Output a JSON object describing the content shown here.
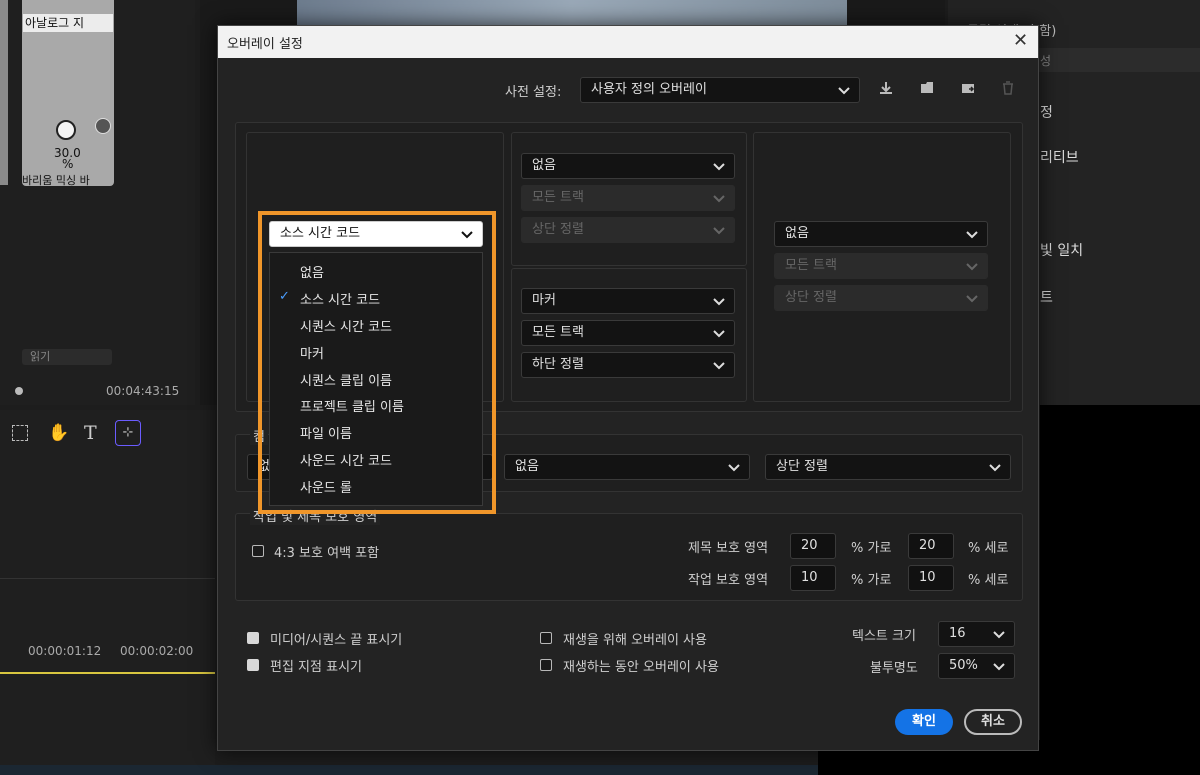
{
  "background": {
    "analog_label": "아날로그 지",
    "knob_value": "30.0",
    "knob_unit": "%",
    "mix_label": "바리움 믹싱 바",
    "read_label": "읽기",
    "timecode": "00:04:43:15",
    "timeline_ticks": [
      "00:00:01:12",
      "00:00:02:00"
    ],
    "right_panel": [
      "(클립 선택 안 함)",
      "성",
      "정",
      "리티브",
      "",
      "빛 일치",
      "트"
    ]
  },
  "dialog": {
    "title": "오버레이 설정",
    "preset_label": "사전 설정:",
    "preset_value": "사용자 정의 오버레이",
    "left_select": "소스 시간 코드",
    "mid_top": [
      "없음",
      "모든 트랙",
      "상단 정렬"
    ],
    "mid_bottom": [
      "마커",
      "모든 트랙",
      "하단 정렬"
    ],
    "right_col": [
      "없음",
      "모든 트랙",
      "상단 정렬"
    ],
    "bottom_row_label": "컴",
    "bottom_row": [
      "없",
      "없음",
      "상단 정렬"
    ],
    "dropdown_items": [
      "없음",
      "소스 시간 코드",
      "시퀀스 시간 코드",
      "마커",
      "시퀀스 클립 이름",
      "프로젝트 클립 이름",
      "파일 이름",
      "사운드 시간 코드",
      "사운드 롤"
    ],
    "dropdown_selected": 1,
    "safe_section_title": "작업 및 제목 보호 영역",
    "safe_43_label": "4:3 보호 여백 포함",
    "title_safe_label": "제목 보호 영역",
    "action_safe_label": "작업 보호 영역",
    "title_safe_h": "20",
    "title_safe_v": "20",
    "action_safe_h": "10",
    "action_safe_v": "10",
    "pct_h": "% 가로",
    "pct_v": "% 세로",
    "pct_h2": "% 가로",
    "pct_v2": "% 세로",
    "opt1": "미디어/시퀀스 끝 표시기",
    "opt2": "편집 지점 표시기",
    "opt3": "재생을 위해 오버레이 사용",
    "opt4": "재생하는 동안 오버레이 사용",
    "text_size_label": "텍스트 크기",
    "text_size": "16",
    "opacity_label": "불투명도",
    "opacity": "50%",
    "ok": "확인",
    "cancel": "취소"
  },
  "colors": {
    "highlight": "#f0962a",
    "ok": "#1473e6"
  }
}
